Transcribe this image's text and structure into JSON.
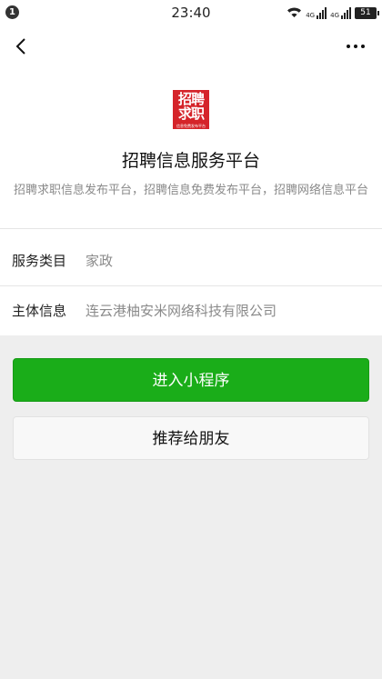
{
  "status_bar": {
    "notification_count": "1",
    "time": "23:40",
    "signal_label_1": "4G",
    "signal_label_2": "4G",
    "battery": "51"
  },
  "nav": {
    "back_icon": "chevron-left-icon",
    "more_icon": "more-dots-icon"
  },
  "app": {
    "logo_text_line1": "招聘",
    "logo_text_line2": "求职",
    "logo_text_small": "信息免费发布平台",
    "name": "招聘信息服务平台",
    "description": "招聘求职信息发布平台，招聘信息免费发布平台，招聘网络信息平台"
  },
  "info": [
    {
      "label": "服务类目",
      "value": "家政"
    },
    {
      "label": "主体信息",
      "value": "连云港柚安米网络科技有限公司"
    }
  ],
  "actions": {
    "enter_label": "进入小程序",
    "recommend_label": "推荐给朋友"
  },
  "colors": {
    "primary_green": "#1aad19",
    "logo_red": "#d5242a",
    "secondary_text": "#8a8a8a"
  }
}
